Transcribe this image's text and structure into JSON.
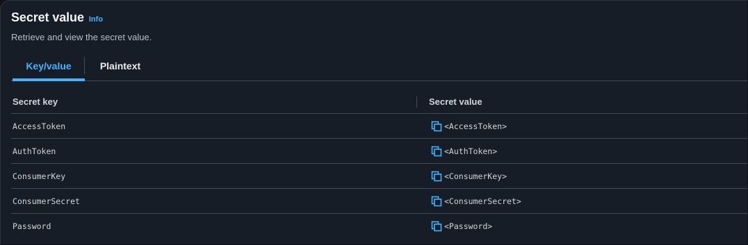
{
  "header": {
    "title": "Secret value",
    "info": "Info",
    "description": "Retrieve and view the secret value."
  },
  "tabs": [
    {
      "label": "Key/value",
      "active": true
    },
    {
      "label": "Plaintext",
      "active": false
    }
  ],
  "table": {
    "columns": [
      "Secret key",
      "Secret value"
    ],
    "rows": [
      {
        "key": "AccessToken",
        "value": "<AccessToken>"
      },
      {
        "key": "AuthToken",
        "value": "<AuthToken>"
      },
      {
        "key": "ConsumerKey",
        "value": "<ConsumerKey>"
      },
      {
        "key": "ConsumerSecret",
        "value": "<ConsumerSecret>"
      },
      {
        "key": "Password",
        "value": "<Password>"
      }
    ]
  },
  "icons": {
    "copy": "copy-icon"
  },
  "colors": {
    "background": "#161d26",
    "accent": "#42b4ff",
    "text": "#d1d5db",
    "border": "#414d5c"
  }
}
